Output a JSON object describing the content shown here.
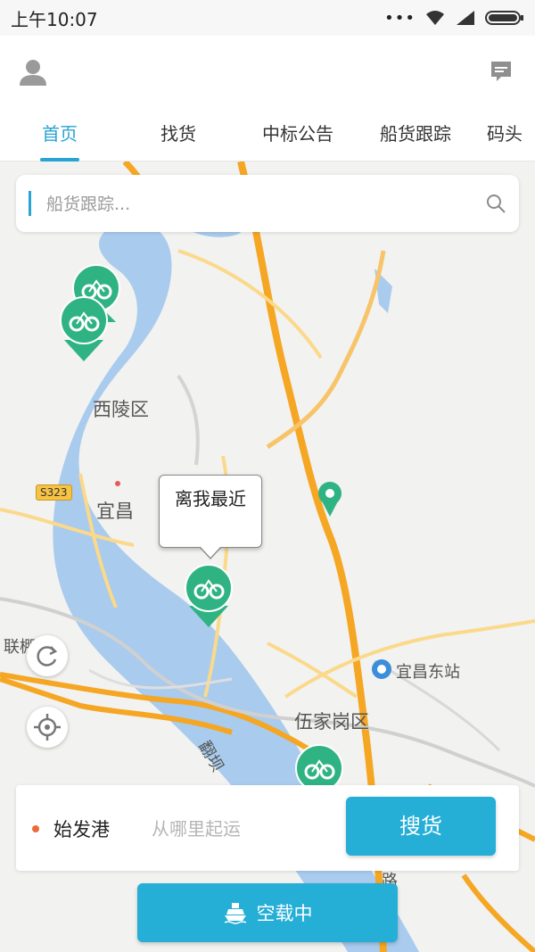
{
  "status_bar": {
    "time": "上午10:07"
  },
  "tabs": [
    {
      "label": "首页"
    },
    {
      "label": "找货"
    },
    {
      "label": "中标公告"
    },
    {
      "label": "船货跟踪"
    },
    {
      "label": "码头"
    }
  ],
  "search": {
    "placeholder": "船货跟踪..."
  },
  "map": {
    "labels": {
      "xiling": "西陵区",
      "yichang": "宜昌",
      "wujiagang": "伍家岗区",
      "yichang_east": "宜昌东站",
      "lian": "联棚",
      "road_s323": "S323",
      "fanxie": "翻坝",
      "lu": "路"
    },
    "callout": "离我最近"
  },
  "panel": {
    "label": "始发港",
    "placeholder": "从哪里起运",
    "search_button": "搜货"
  },
  "bottom_button": {
    "label": "空载中"
  },
  "colors": {
    "accent": "#29a3d3",
    "button": "#25aed6",
    "marker": "#2fb383",
    "dot": "#ec6b3a"
  }
}
